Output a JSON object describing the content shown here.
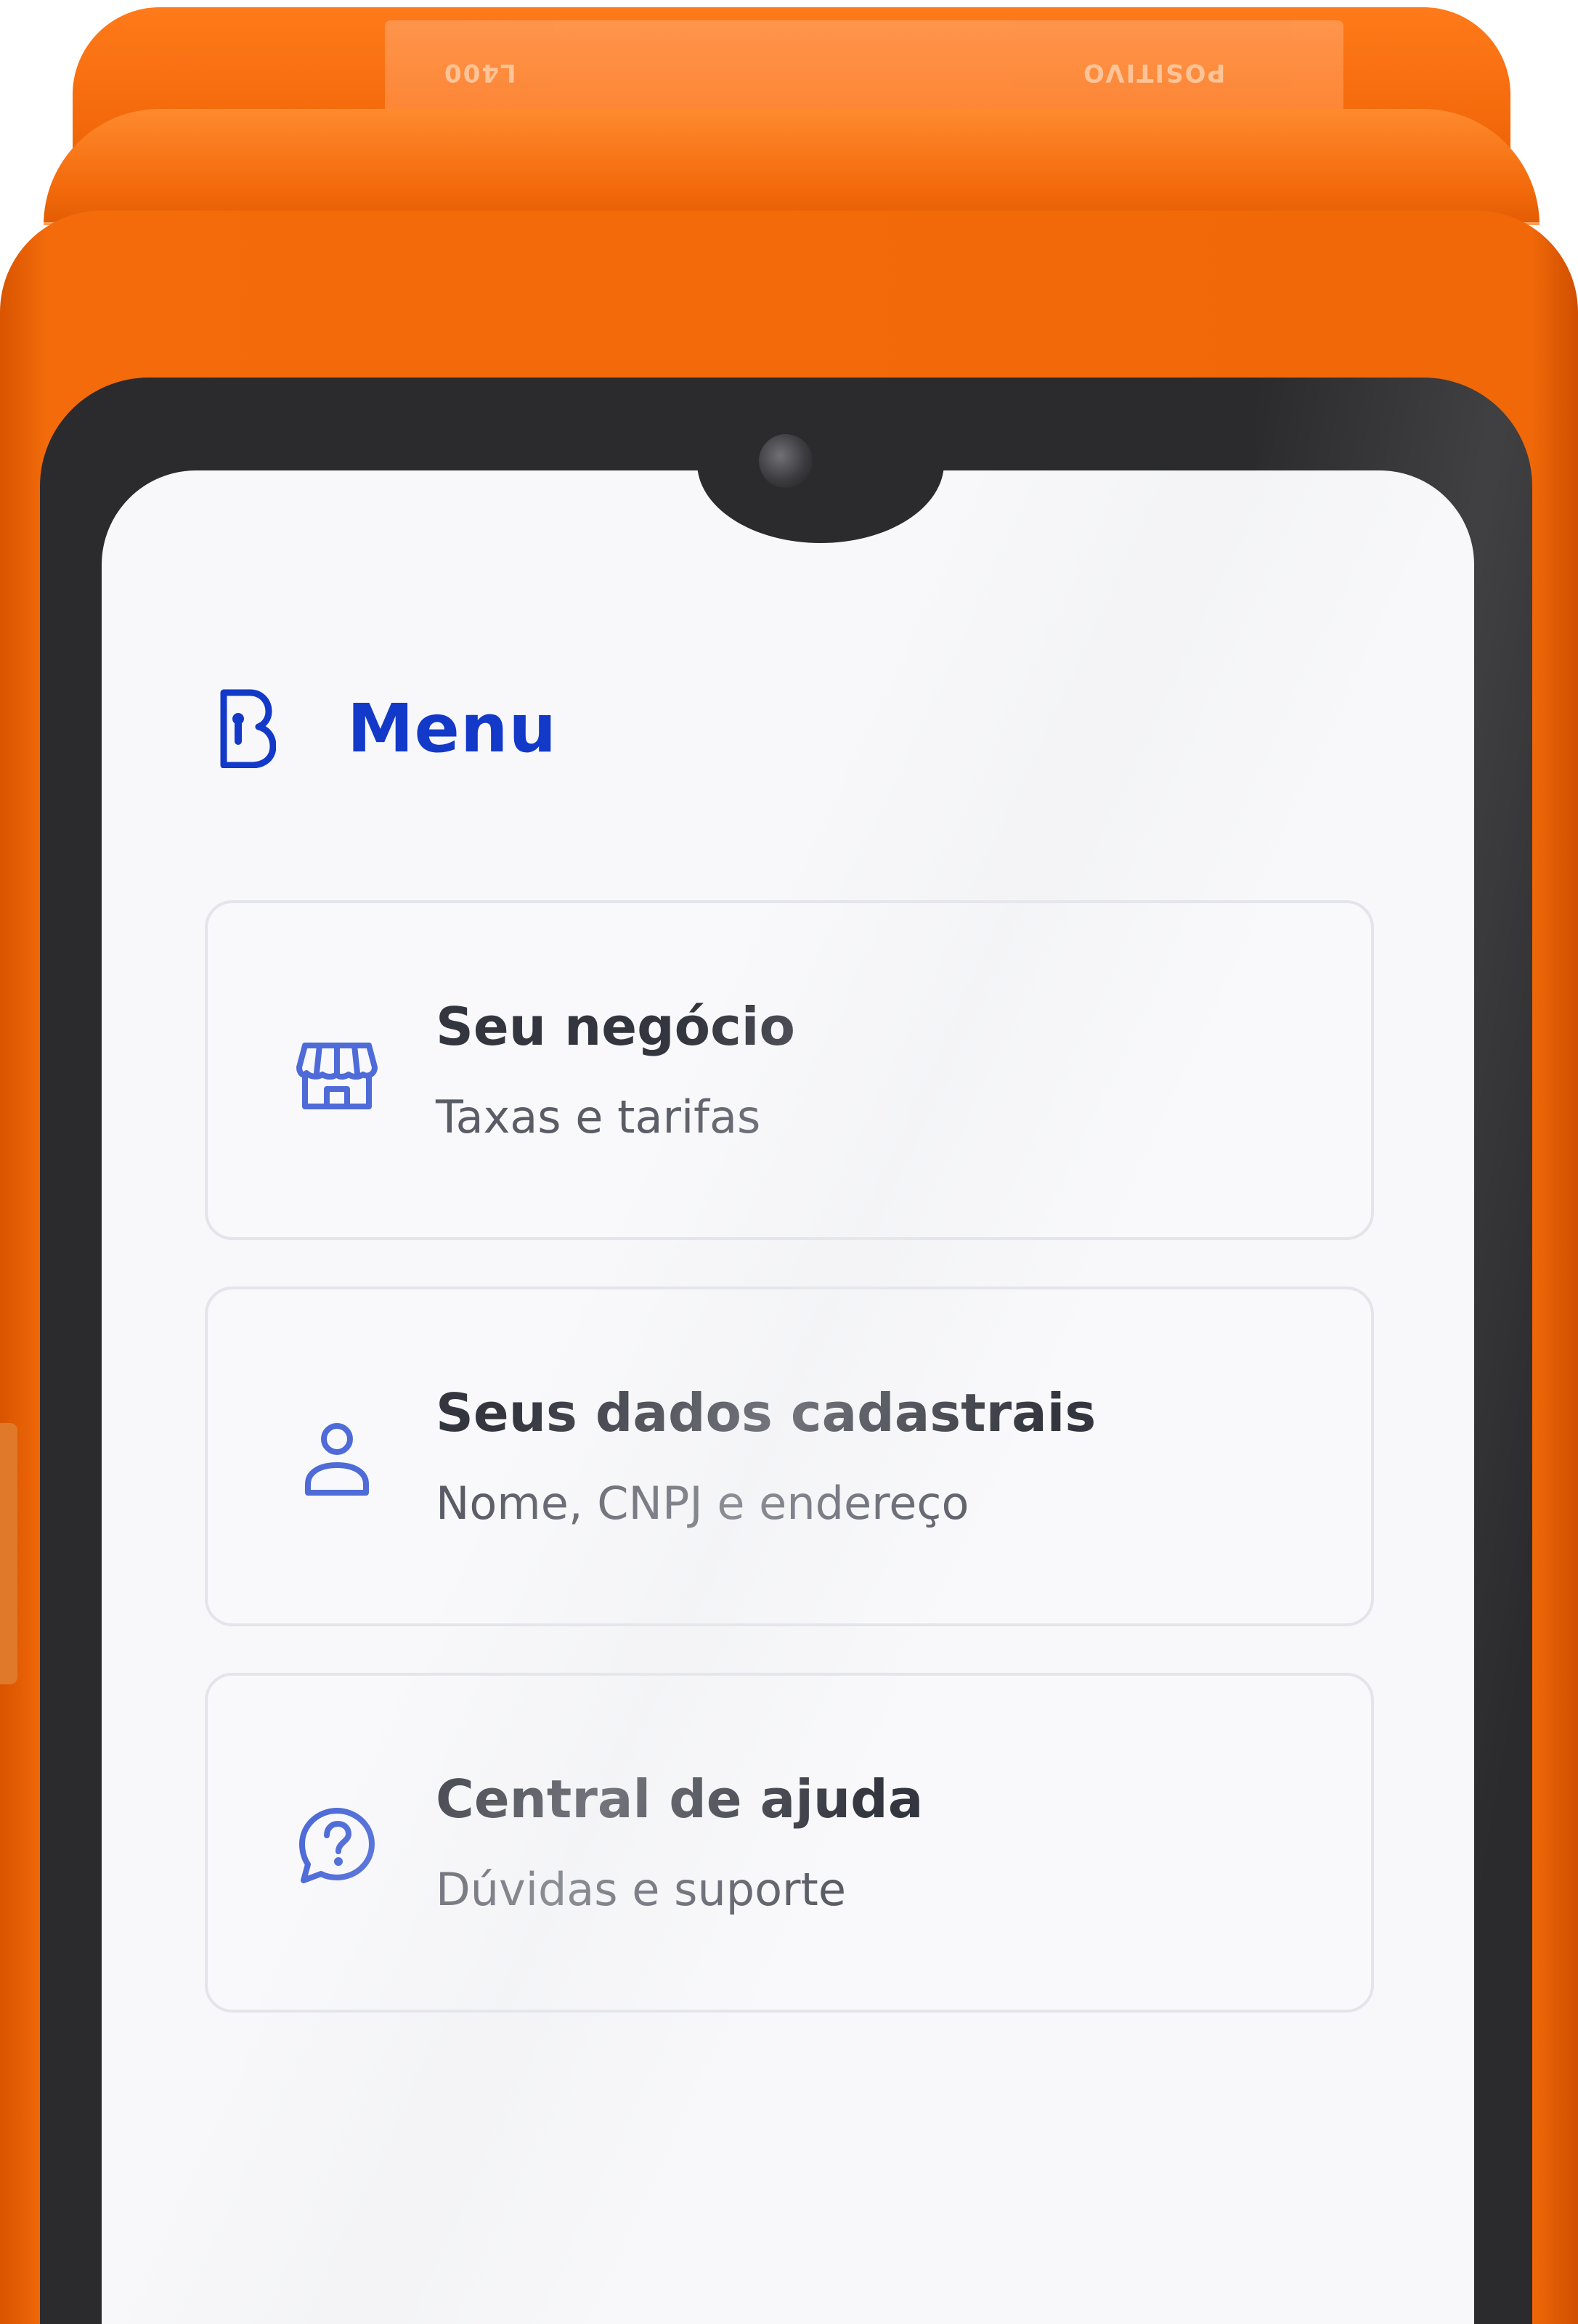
{
  "device": {
    "shell_engrave_left": "L400",
    "shell_engrave_right": "POSITIVO"
  },
  "header": {
    "title": "Menu",
    "logo_icon": "brand-b-logo-icon"
  },
  "menu": {
    "items": [
      {
        "title": "Seu negócio",
        "subtitle": "Taxas e tarifas",
        "icon": "storefront-icon"
      },
      {
        "title": "Seus dados cadastrais",
        "subtitle": "Nome, CNPJ e endereço",
        "icon": "user-icon"
      },
      {
        "title": "Central de ajuda",
        "subtitle": "Dúvidas e suporte",
        "icon": "help-chat-icon"
      }
    ]
  },
  "colors": {
    "accent": "#1339C9",
    "icon": "#4E6BD8",
    "device_orange": "#F36B0B",
    "card_border": "#E3E4EC",
    "title_text": "#34363F",
    "subtitle_text": "#5A5C66"
  }
}
